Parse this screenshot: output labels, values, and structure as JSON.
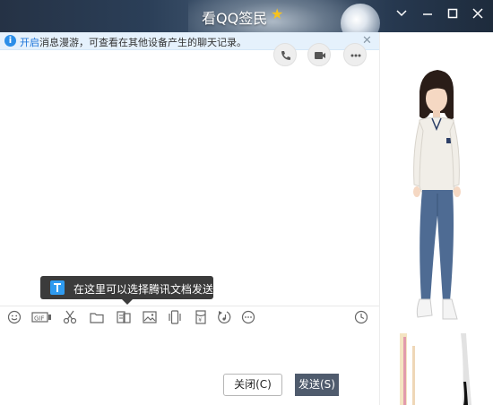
{
  "window": {
    "title": "看QQ签民",
    "controls": [
      "chevron-down",
      "minimize",
      "maximize",
      "close"
    ]
  },
  "notice": {
    "link_text": "开启",
    "text": "消息漫游，可查看在其他设备产生的聊天记录。"
  },
  "tooltip": {
    "text": "在这里可以选择腾讯文档发送"
  },
  "toolbar": {
    "tools": [
      "emoji-icon",
      "gif-icon",
      "scissors-icon",
      "folder-icon",
      "tencent-doc-icon",
      "image-icon",
      "shake-icon",
      "red-packet-icon",
      "music-icon",
      "more-icon",
      "history-clock-icon"
    ],
    "gif_label": "GIF"
  },
  "buttons": {
    "close_label": "关闭(C)",
    "send_label": "发送(S)"
  },
  "colors": {
    "accent": "#1a73d9",
    "send_button": "#4f5b6d",
    "notice_bg": "#e5f1fc",
    "titlebar": "#2b3f58"
  }
}
